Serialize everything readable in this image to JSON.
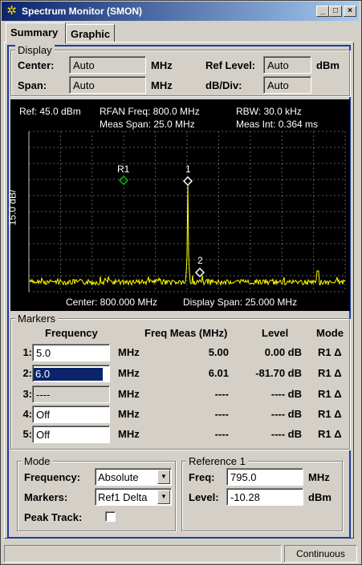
{
  "window": {
    "title": "Spectrum Monitor (SMON)",
    "buttons": {
      "minimize": "_",
      "maximize": "□",
      "close": "×"
    }
  },
  "tabs": [
    {
      "label": "Summary",
      "active": true
    },
    {
      "label": "Graphic",
      "active": false
    }
  ],
  "display": {
    "group_title": "Display",
    "center_label": "Center:",
    "center_value": "Auto",
    "center_unit": "MHz",
    "span_label": "Span:",
    "span_value": "Auto",
    "span_unit": "MHz",
    "ref_level_label": "Ref Level:",
    "ref_level_value": "Auto",
    "ref_level_unit": "dBm",
    "db_div_label": "dB/Div:",
    "db_div_value": "Auto"
  },
  "graph": {
    "ref": "Ref: 45.0 dBm",
    "rfan_freq": "RFAN Freq: 800.0 MHz",
    "meas_span": "Meas Span: 25.0 MHz",
    "rbw": "RBW: 30.0 kHz",
    "meas_int": "Meas Int: 0.364 ms",
    "y_label": "15.0 dB/",
    "center": "Center: 800.000 MHz",
    "display_span": "Display Span: 25.000 MHz",
    "marker_labels": {
      "r1": "R1",
      "m1": "1",
      "m2": "2"
    },
    "trace_color": "#ffff00",
    "ref_marker_color": "#00c000",
    "grid_color": "#606060"
  },
  "markers": {
    "group_title": "Markers",
    "headers": {
      "frequency": "Frequency",
      "freq_meas": "Freq Meas (MHz)",
      "level": "Level",
      "mode": "Mode"
    },
    "rows": [
      {
        "label": "1:",
        "freq": "5.0",
        "unit": "MHz",
        "meas": "5.00",
        "level": "0.00 dB",
        "mode": "R1 Δ"
      },
      {
        "label": "2:",
        "freq": "6.0",
        "unit": "MHz",
        "meas": "6.01",
        "level": "-81.70 dB",
        "mode": "R1 Δ"
      },
      {
        "label": "3:",
        "freq": "----",
        "unit": "MHz",
        "meas": "----",
        "level": "---- dB",
        "mode": "R1 Δ"
      },
      {
        "label": "4:",
        "freq": "Off",
        "unit": "MHz",
        "meas": "----",
        "level": "---- dB",
        "mode": "R1 Δ"
      },
      {
        "label": "5:",
        "freq": "Off",
        "unit": "MHz",
        "meas": "----",
        "level": "---- dB",
        "mode": "R1 Δ"
      }
    ]
  },
  "mode": {
    "group_title": "Mode",
    "frequency_label": "Frequency:",
    "frequency_value": "Absolute",
    "markers_label": "Markers:",
    "markers_value": "Ref1 Delta",
    "peak_track_label": "Peak Track:",
    "peak_track_checked": false
  },
  "reference": {
    "group_title": "Reference 1",
    "freq_label": "Freq:",
    "freq_value": "795.0",
    "freq_unit": "MHz",
    "level_label": "Level:",
    "level_value": "-10.28",
    "level_unit": "dBm"
  },
  "status_bar": {
    "left": "",
    "right": "Continuous"
  }
}
